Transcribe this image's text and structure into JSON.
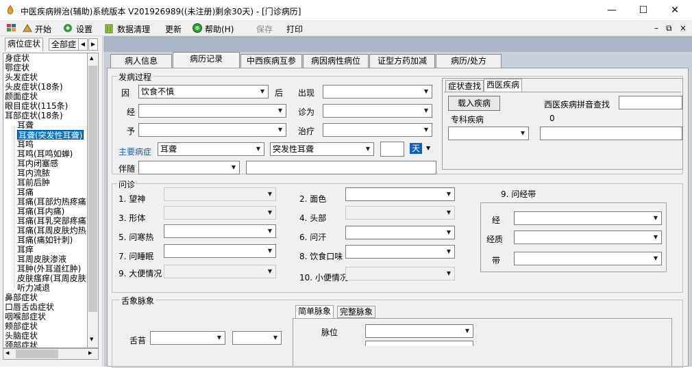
{
  "window": {
    "title": "中医疾病辨治(辅助)系统版本 V201926989((未注册)剩余30天) - [门诊病历]",
    "minimize": "—",
    "maximize": "☐",
    "close": "✕"
  },
  "menu": {
    "items": [
      "开始",
      "设置",
      "数据清理",
      "更新",
      "帮助(H)",
      "保存",
      "打印"
    ],
    "mdi_controls": [
      "–",
      "⧉",
      "×"
    ]
  },
  "left": {
    "tabs": [
      "病位症状",
      "全部症"
    ],
    "nav": [
      "◀",
      "▶"
    ],
    "tree": [
      {
        "text": "身症状",
        "level": 0
      },
      {
        "text": "鄂症状",
        "level": 0
      },
      {
        "text": "头发症状",
        "level": 0
      },
      {
        "text": "头皮症状(18条)",
        "level": 0
      },
      {
        "text": "颜面症状",
        "level": 0
      },
      {
        "text": "眼目症状(115条)",
        "level": 0
      },
      {
        "text": "耳部症状(18条)",
        "level": 0
      },
      {
        "text": "耳聋",
        "level": 1
      },
      {
        "text": "耳聋(突发性耳聋)",
        "level": 1,
        "selected": true
      },
      {
        "text": "耳鸣",
        "level": 1
      },
      {
        "text": "耳鸣(耳鸣如蝉)",
        "level": 1
      },
      {
        "text": "耳内闭塞感",
        "level": 1
      },
      {
        "text": "耳内流脓",
        "level": 1
      },
      {
        "text": "耳前后肿",
        "level": 1
      },
      {
        "text": "耳痛",
        "level": 1
      },
      {
        "text": "耳痛(耳部灼热疼痛",
        "level": 1
      },
      {
        "text": "耳痛(耳内痛)",
        "level": 1
      },
      {
        "text": "耳痛(耳乳突部疼痛",
        "level": 1
      },
      {
        "text": "耳痛(耳周皮肤灼热",
        "level": 1
      },
      {
        "text": "耳痛(痛如针刺)",
        "level": 1
      },
      {
        "text": "耳痒",
        "level": 1
      },
      {
        "text": "耳周皮肤渗液",
        "level": 1
      },
      {
        "text": "耳肿(外耳道红肿)",
        "level": 1
      },
      {
        "text": "皮肤瘙痒(耳周皮肤",
        "level": 1
      },
      {
        "text": "听力减退",
        "level": 1
      },
      {
        "text": "鼻部症状",
        "level": 0
      },
      {
        "text": "口唇舌齿症状",
        "level": 0
      },
      {
        "text": "咽喉部症状",
        "level": 0
      },
      {
        "text": "颊部症状",
        "level": 0
      },
      {
        "text": "头脑症状",
        "level": 0
      },
      {
        "text": "颈部症状",
        "level": 0
      }
    ]
  },
  "tabs": [
    "病人信息",
    "病历记录",
    "中西疾病互参",
    "病因病性病位",
    "证型方药加减",
    "病历/处方"
  ],
  "onset": {
    "legend": "发病过程",
    "rows": [
      {
        "label": "因",
        "value": "饮食不慎",
        "suffix": "后",
        "label2": "出现",
        "value2": ""
      },
      {
        "label": "经",
        "value": "",
        "label2": "诊为",
        "value2": ""
      },
      {
        "label": "予",
        "value": "",
        "label2": "治疗",
        "value2": ""
      }
    ],
    "main_label": "主要病症",
    "main_value": "耳聋",
    "main_value2": "突发性耳聋",
    "main_unit": "天",
    "accompany_label": "伴随"
  },
  "disease_panel": {
    "tabs": [
      "症状查找",
      "西医疾病"
    ],
    "load_button": "载入疾病",
    "pinyin_label": "西医疾病拼音查找",
    "special_label": "专科疾病",
    "count": "0"
  },
  "inquiry": {
    "legend": "问诊",
    "items": [
      "1. 望神",
      "2. 面色",
      "3. 形体",
      "4. 头部",
      "5. 问寒热",
      "6. 问汗",
      "7. 问睡眠",
      "8. 饮食口味",
      "9. 大便情况",
      "10. 小便情况"
    ],
    "menses_title": "9. 问经带",
    "menses": [
      "经",
      "经质",
      "带"
    ]
  },
  "tongue": {
    "legend": "舌象脉象",
    "tongue_label": "舌苔",
    "pulse_tabs": [
      "简单脉象",
      "完整脉象"
    ],
    "pulse_label": "脉位"
  },
  "colors": {
    "accent": "#0078d7",
    "blue_label": "#1a5fb4",
    "band": "#aab6c8"
  }
}
